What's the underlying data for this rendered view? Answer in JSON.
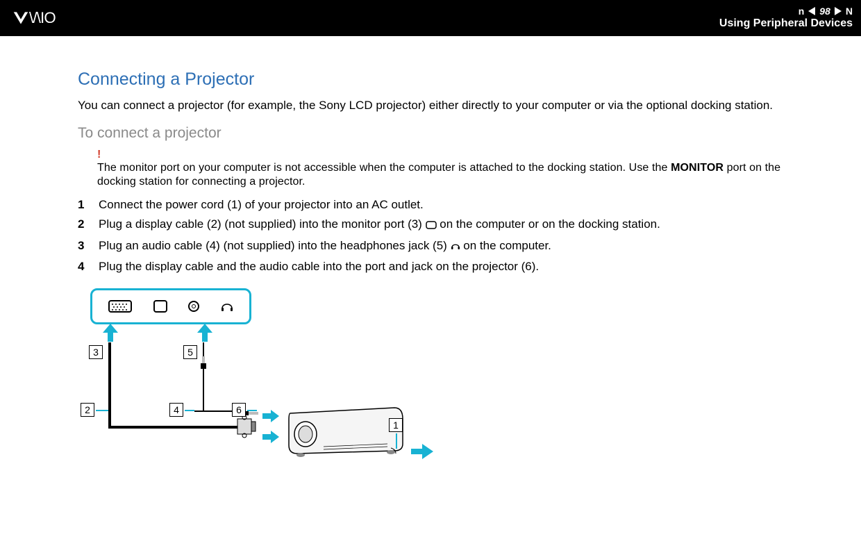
{
  "header": {
    "page_number": "98",
    "nav_prev_letter": "n",
    "nav_next_letter": "N",
    "chapter_title": "Using Peripheral Devices"
  },
  "content": {
    "section_title": "Connecting a Projector",
    "intro": "You can connect a projector (for example, the Sony LCD projector) either directly to your computer or via the optional docking station.",
    "subheading": "To connect a projector",
    "warning_mark": "!",
    "note_pre": "The monitor port on your computer is not accessible when the computer is attached to the docking station. Use the ",
    "note_bold": "MONITOR",
    "note_post": " port on the docking station for connecting a projector.",
    "steps": [
      {
        "n": "1",
        "text": "Connect the power cord (1) of your projector into an AC outlet."
      },
      {
        "n": "2",
        "pre": "Plug a display cable (2) (not supplied) into the monitor port (3) ",
        "post": " on the computer or on the docking station."
      },
      {
        "n": "3",
        "pre": "Plug an audio cable (4) (not supplied) into the headphones jack (5) ",
        "post": " on the computer."
      },
      {
        "n": "4",
        "text": "Plug the display cable and the audio cable into the port and jack on the projector (6)."
      }
    ],
    "callouts": {
      "c1": "1",
      "c2": "2",
      "c3": "3",
      "c4": "4",
      "c5": "5",
      "c6": "6"
    }
  }
}
